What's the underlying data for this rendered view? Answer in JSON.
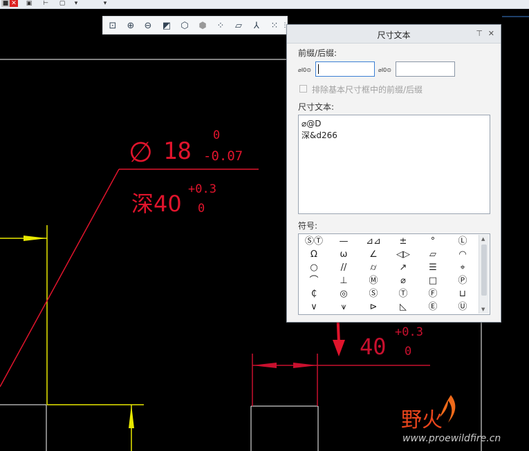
{
  "panel": {
    "title": "尺寸文本",
    "pin_glyph": "⊤",
    "close_glyph": "✕",
    "prefix_suffix_label": "前缀/后缀:",
    "prefix_icon": "⌀I0⊙",
    "prefix_value": "",
    "suffix_icon": "⌀I0⊙",
    "suffix_value": "",
    "exclude_label": "排除基本尺寸框中的前缀/后缀",
    "dim_text_label": "尺寸文本:",
    "dim_text_lines": [
      "⌀@D",
      "深&d266"
    ],
    "symbols_label": "符号:",
    "symbols": [
      [
        "ⓈⓉ",
        "—",
        "⊿⊿",
        "±",
        "°",
        "Ⓛ"
      ],
      [
        "Ω",
        "ω",
        "∠",
        "◁▷",
        "▱",
        "◠"
      ],
      [
        "○",
        "//",
        "⌭",
        "↗",
        "☰",
        "⌖"
      ],
      [
        "⌒",
        "⊥",
        "Ⓜ",
        "⌀",
        "□",
        "Ⓟ"
      ],
      [
        "₵",
        "◎",
        "Ⓢ",
        "Ⓣ",
        "Ⓕ",
        "⊔"
      ],
      [
        "∨",
        "⩛",
        "⊳",
        "◺",
        "Ⓔ",
        "Ⓤ"
      ]
    ]
  },
  "drawing": {
    "dia_symbol": "∅",
    "dia_value": "18",
    "dia_tol_upper": "0",
    "dia_tol_lower": "-0.07",
    "depth_value": "深40",
    "depth_tol_upper": "+0.3",
    "depth_tol_lower": "0",
    "dim_value": "40",
    "dim_tol_upper": "+0.3",
    "dim_tol_lower": "0"
  },
  "watermark": {
    "brand": "野火",
    "url": "www.proewildfire.cn"
  },
  "colors": {
    "dimension_red": "#e0142c",
    "yellow": "#e8e800",
    "panel_bg": "#f3f3f3",
    "accent": "#3b7fd4"
  },
  "icons": {
    "top_toolbar": [
      "stop-icon",
      "close-red-icon",
      "print-icon",
      "tree-icon",
      "cube-icon",
      "dropdown-icon"
    ],
    "view_toolbar": [
      "zoom-fit-icon",
      "zoom-in-icon",
      "zoom-out-icon",
      "repaint-icon",
      "shaded-cube-icon",
      "orient-icon",
      "datum-points-icon",
      "annotations-icon",
      "csys-icon",
      "datum-axes-icon",
      "more-icon"
    ]
  }
}
